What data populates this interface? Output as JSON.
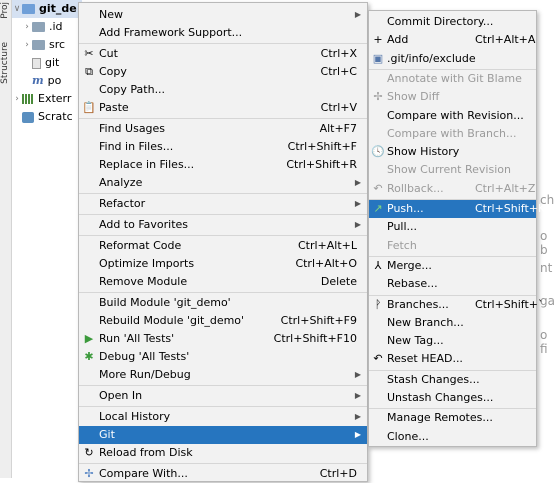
{
  "strip": {
    "tabs": [
      "Proj",
      "Structure"
    ]
  },
  "tree": {
    "rows": [
      "git_de",
      ".id",
      "src",
      "git",
      "po",
      "Exterr",
      "Scratc"
    ]
  },
  "editor_text": [
    "ch",
    "o b",
    "nt",
    "ga",
    "o fi"
  ],
  "main_menu": {
    "items": [
      {
        "name": "new",
        "label": "New",
        "shortcut": "",
        "arrow": true,
        "icon": ""
      },
      {
        "name": "add-framework-support",
        "label": "Add Framework Support...",
        "shortcut": "",
        "arrow": false,
        "icon": ""
      },
      {
        "sep": true
      },
      {
        "name": "cut",
        "label": "Cut",
        "shortcut": "Ctrl+X",
        "arrow": false,
        "icon": "✂"
      },
      {
        "name": "copy",
        "label": "Copy",
        "shortcut": "Ctrl+C",
        "arrow": false,
        "icon": "⧉"
      },
      {
        "name": "copy-path",
        "label": "Copy Path...",
        "shortcut": "",
        "arrow": false,
        "icon": ""
      },
      {
        "name": "paste",
        "label": "Paste",
        "shortcut": "Ctrl+V",
        "arrow": false,
        "icon": "📋"
      },
      {
        "sep": true
      },
      {
        "name": "find-usages",
        "label": "Find Usages",
        "shortcut": "Alt+F7",
        "arrow": false,
        "icon": ""
      },
      {
        "name": "find-in-files",
        "label": "Find in Files...",
        "shortcut": "Ctrl+Shift+F",
        "arrow": false,
        "icon": ""
      },
      {
        "name": "replace-in-files",
        "label": "Replace in Files...",
        "shortcut": "Ctrl+Shift+R",
        "arrow": false,
        "icon": ""
      },
      {
        "name": "analyze",
        "label": "Analyze",
        "shortcut": "",
        "arrow": true,
        "icon": ""
      },
      {
        "sep": true
      },
      {
        "name": "refactor",
        "label": "Refactor",
        "shortcut": "",
        "arrow": true,
        "icon": ""
      },
      {
        "sep": true
      },
      {
        "name": "add-to-favorites",
        "label": "Add to Favorites",
        "shortcut": "",
        "arrow": true,
        "icon": ""
      },
      {
        "sep": true
      },
      {
        "name": "reformat-code",
        "label": "Reformat Code",
        "shortcut": "Ctrl+Alt+L",
        "arrow": false,
        "icon": ""
      },
      {
        "name": "optimize-imports",
        "label": "Optimize Imports",
        "shortcut": "Ctrl+Alt+O",
        "arrow": false,
        "icon": ""
      },
      {
        "name": "remove-module",
        "label": "Remove Module",
        "shortcut": "Delete",
        "arrow": false,
        "icon": ""
      },
      {
        "sep": true
      },
      {
        "name": "build-module",
        "label": "Build Module 'git_demo'",
        "shortcut": "",
        "arrow": false,
        "icon": ""
      },
      {
        "name": "rebuild-module",
        "label": "Rebuild Module 'git_demo'",
        "shortcut": "Ctrl+Shift+F9",
        "arrow": false,
        "icon": ""
      },
      {
        "name": "run-all-tests",
        "label": "Run 'All Tests'",
        "shortcut": "Ctrl+Shift+F10",
        "arrow": false,
        "icon": "▶",
        "icon_color": "#3c9a3c"
      },
      {
        "name": "debug-all-tests",
        "label": "Debug 'All Tests'",
        "shortcut": "",
        "arrow": false,
        "icon": "✱",
        "icon_color": "#3c9a3c"
      },
      {
        "name": "more-run-debug",
        "label": "More Run/Debug",
        "shortcut": "",
        "arrow": true,
        "icon": ""
      },
      {
        "sep": true
      },
      {
        "name": "open-in",
        "label": "Open In",
        "shortcut": "",
        "arrow": true,
        "icon": ""
      },
      {
        "sep": true
      },
      {
        "name": "local-history",
        "label": "Local History",
        "shortcut": "",
        "arrow": true,
        "icon": ""
      },
      {
        "name": "git",
        "label": "Git",
        "shortcut": "",
        "arrow": true,
        "icon": "",
        "active": true
      },
      {
        "name": "reload-from-disk",
        "label": "Reload from Disk",
        "shortcut": "",
        "arrow": false,
        "icon": "↻"
      },
      {
        "sep": true
      },
      {
        "name": "compare-with",
        "label": "Compare With...",
        "shortcut": "Ctrl+D",
        "arrow": false,
        "icon": "✢",
        "icon_color": "#4a7cc0"
      }
    ]
  },
  "git_menu": {
    "items": [
      {
        "name": "commit-directory",
        "label": "Commit Directory...",
        "shortcut": "",
        "icon": ""
      },
      {
        "name": "add",
        "label": "Add",
        "shortcut": "Ctrl+Alt+A",
        "icon": "+"
      },
      {
        "name": "git-info-exclude",
        "label": ".git/info/exclude",
        "shortcut": "",
        "icon": "▣",
        "icon_color": "#5577aa"
      },
      {
        "sep": true
      },
      {
        "name": "annotate-with-git-blame",
        "label": "Annotate with Git Blame",
        "shortcut": "",
        "icon": "",
        "disabled": true
      },
      {
        "name": "show-diff",
        "label": "Show Diff",
        "shortcut": "",
        "icon": "✢",
        "disabled": true
      },
      {
        "name": "compare-with-revision",
        "label": "Compare with Revision...",
        "shortcut": "",
        "icon": ""
      },
      {
        "name": "compare-with-branch",
        "label": "Compare with Branch...",
        "shortcut": "",
        "icon": "",
        "disabled": true
      },
      {
        "name": "show-history",
        "label": "Show History",
        "shortcut": "",
        "icon": "🕓"
      },
      {
        "name": "show-current-revision",
        "label": "Show Current Revision",
        "shortcut": "",
        "icon": "",
        "disabled": true
      },
      {
        "name": "rollback",
        "label": "Rollback...",
        "shortcut": "Ctrl+Alt+Z",
        "icon": "↶",
        "disabled": true
      },
      {
        "sep": true
      },
      {
        "name": "push",
        "label": "Push...",
        "shortcut": "Ctrl+Shift+K",
        "icon": "↗",
        "icon_color": "#7fd67f",
        "active": true
      },
      {
        "name": "pull",
        "label": "Pull...",
        "shortcut": "",
        "icon": ""
      },
      {
        "name": "fetch",
        "label": "Fetch",
        "shortcut": "",
        "icon": "",
        "disabled": true
      },
      {
        "sep": true
      },
      {
        "name": "merge",
        "label": "Merge...",
        "shortcut": "",
        "icon": "⅄"
      },
      {
        "name": "rebase",
        "label": "Rebase...",
        "shortcut": "",
        "icon": ""
      },
      {
        "sep": true
      },
      {
        "name": "branches",
        "label": "Branches...",
        "shortcut": "Ctrl+Shift+`",
        "icon": "ᚹ"
      },
      {
        "name": "new-branch",
        "label": "New Branch...",
        "shortcut": "",
        "icon": ""
      },
      {
        "name": "new-tag",
        "label": "New Tag...",
        "shortcut": "",
        "icon": ""
      },
      {
        "name": "reset-head",
        "label": "Reset HEAD...",
        "shortcut": "",
        "icon": "↶"
      },
      {
        "sep": true
      },
      {
        "name": "stash-changes",
        "label": "Stash Changes...",
        "shortcut": "",
        "icon": ""
      },
      {
        "name": "unstash-changes",
        "label": "Unstash Changes...",
        "shortcut": "",
        "icon": ""
      },
      {
        "sep": true
      },
      {
        "name": "manage-remotes",
        "label": "Manage Remotes...",
        "shortcut": "",
        "icon": ""
      },
      {
        "name": "clone",
        "label": "Clone...",
        "shortcut": "",
        "icon": ""
      }
    ]
  }
}
